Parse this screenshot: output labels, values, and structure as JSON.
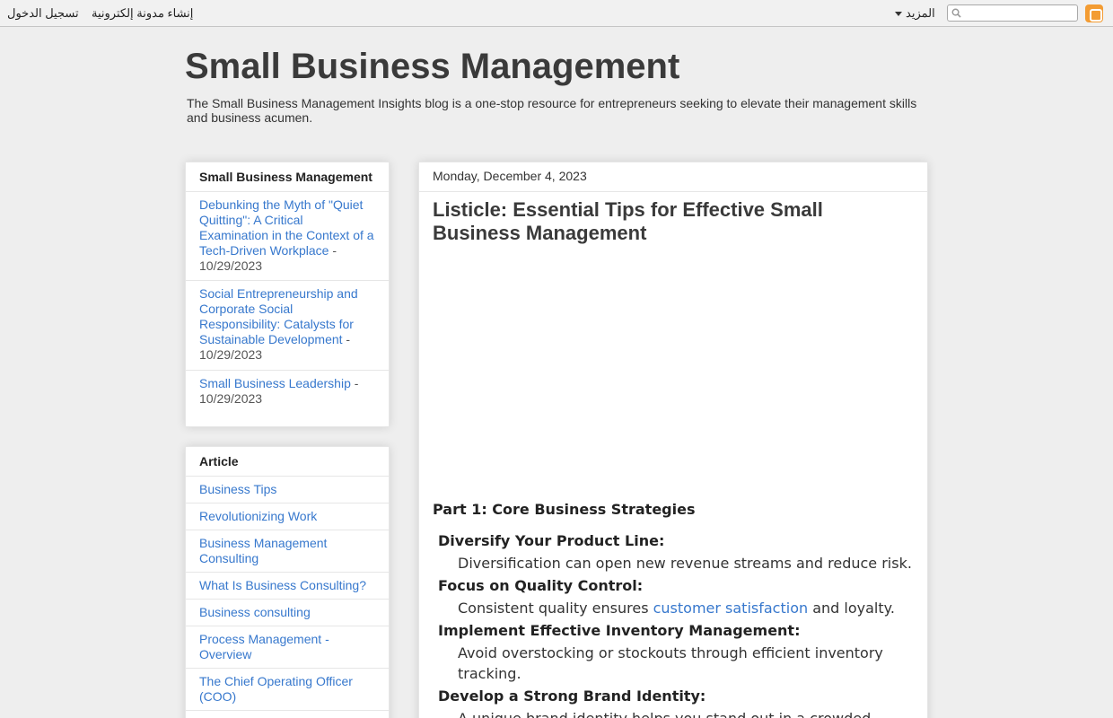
{
  "navbar": {
    "signin": "تسجيل الدخول",
    "create_blog": "إنشاء مدونة إلكترونية",
    "more": "المزيد",
    "search_placeholder": ""
  },
  "header": {
    "title": "Small Business Management",
    "description": "The Small Business Management Insights blog is a one-stop resource for entrepreneurs seeking to elevate their management skills and business acumen."
  },
  "sidebar": {
    "recent_title": "Small Business Management",
    "recent_posts": [
      {
        "title": "Debunking the Myth of \"Quiet Quitting\": A Critical Examination in the Context of a Tech-Driven Workplace",
        "date": " - 10/29/2023"
      },
      {
        "title": "Social Entrepreneurship and Corporate Social Responsibility: Catalysts for Sustainable Development",
        "date": " - 10/29/2023"
      },
      {
        "title": "Small Business Leadership",
        "date": " - 10/29/2023"
      }
    ],
    "article_title": "Article",
    "articles": [
      "Business Tips",
      "Revolutionizing Work",
      "Business Management Consulting",
      "What Is Business Consulting?",
      "Business consulting",
      "Process Management - Overview",
      "The Chief Operating Officer (COO)"
    ]
  },
  "post": {
    "date": "Monday, December 4, 2023",
    "title": "Listicle: Essential Tips for Effective Small Business Management",
    "section": "Part 1: Core Business Strategies",
    "tips": [
      {
        "term": "Diversify Your Product Line:",
        "desc_before": "Diversification can open new revenue streams and reduce risk.",
        "link": "",
        "desc_after": ""
      },
      {
        "term": "Focus on Quality Control:",
        "desc_before": "Consistent quality ensures ",
        "link": "customer satisfaction",
        "desc_after": " and loyalty."
      },
      {
        "term": "Implement Effective Inventory Management:",
        "desc_before": "Avoid overstocking or stockouts through efficient inventory tracking.",
        "link": "",
        "desc_after": ""
      },
      {
        "term": "Develop a Strong Brand Identity:",
        "desc_before": "A unique brand identity helps you stand out in a crowded market.",
        "link": "",
        "desc_after": ""
      }
    ]
  }
}
